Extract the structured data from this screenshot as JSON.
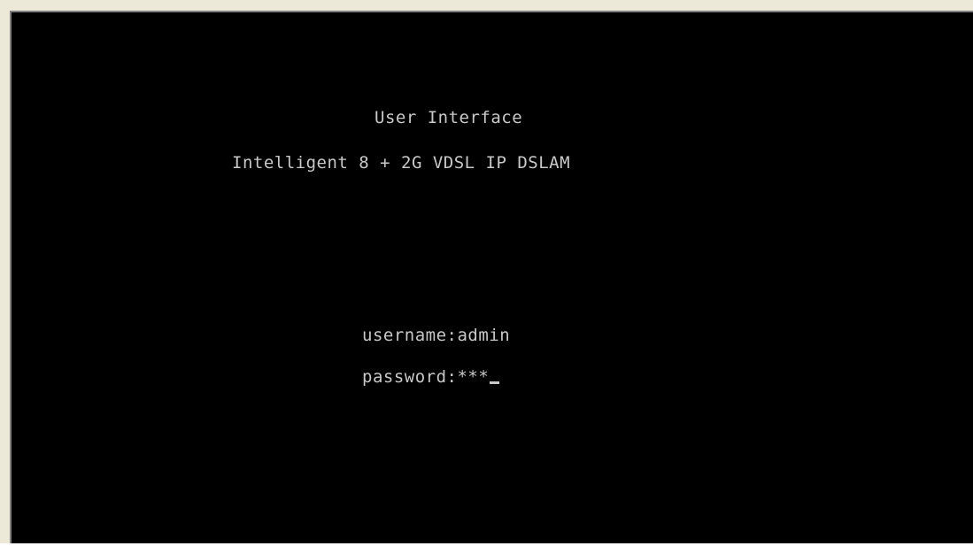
{
  "terminal": {
    "title": "User Interface",
    "subtitle": "Intelligent 8 + 2G VDSL IP DSLAM",
    "login": {
      "username_label": "username:",
      "username_value": "admin",
      "password_label": "password:",
      "password_value": "***"
    }
  },
  "colors": {
    "background": "#000000",
    "text": "#c8c8c8",
    "frame": "#ece9d8"
  }
}
